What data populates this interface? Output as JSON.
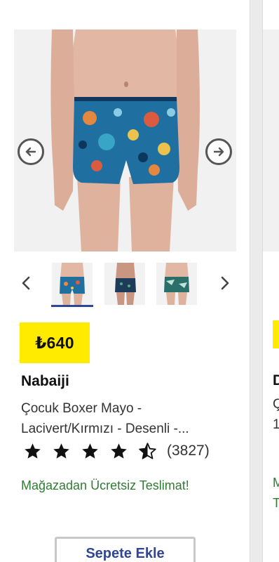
{
  "product": {
    "price": "₺640",
    "brand": "Nabaiji",
    "title": "Çocuk Boxer Mayo - Lacivert/Kırmızı - Desenli -...",
    "rating": 4.5,
    "review_count": "(3827)",
    "delivery": "Mağazadan Ücretsiz Teslimat!",
    "add_to_cart": "Sepete Ekle",
    "thumbnails": [
      {
        "name": "front view boxer"
      },
      {
        "name": "model side view"
      },
      {
        "name": "camouflage variant"
      }
    ]
  },
  "next_card": {
    "title_initial": "D",
    "title_line1": "Ç",
    "title_line2": "1",
    "delivery_line1": "M",
    "delivery_line2": "T"
  },
  "colors": {
    "price_bg": "#ffeb00",
    "brand_blue": "#2f4595",
    "delivery_green": "#2e7d32"
  },
  "icons": [
    "arrow-left-icon",
    "arrow-right-icon",
    "chevron-left-icon",
    "chevron-right-icon",
    "star-icon",
    "half-star-icon"
  ]
}
